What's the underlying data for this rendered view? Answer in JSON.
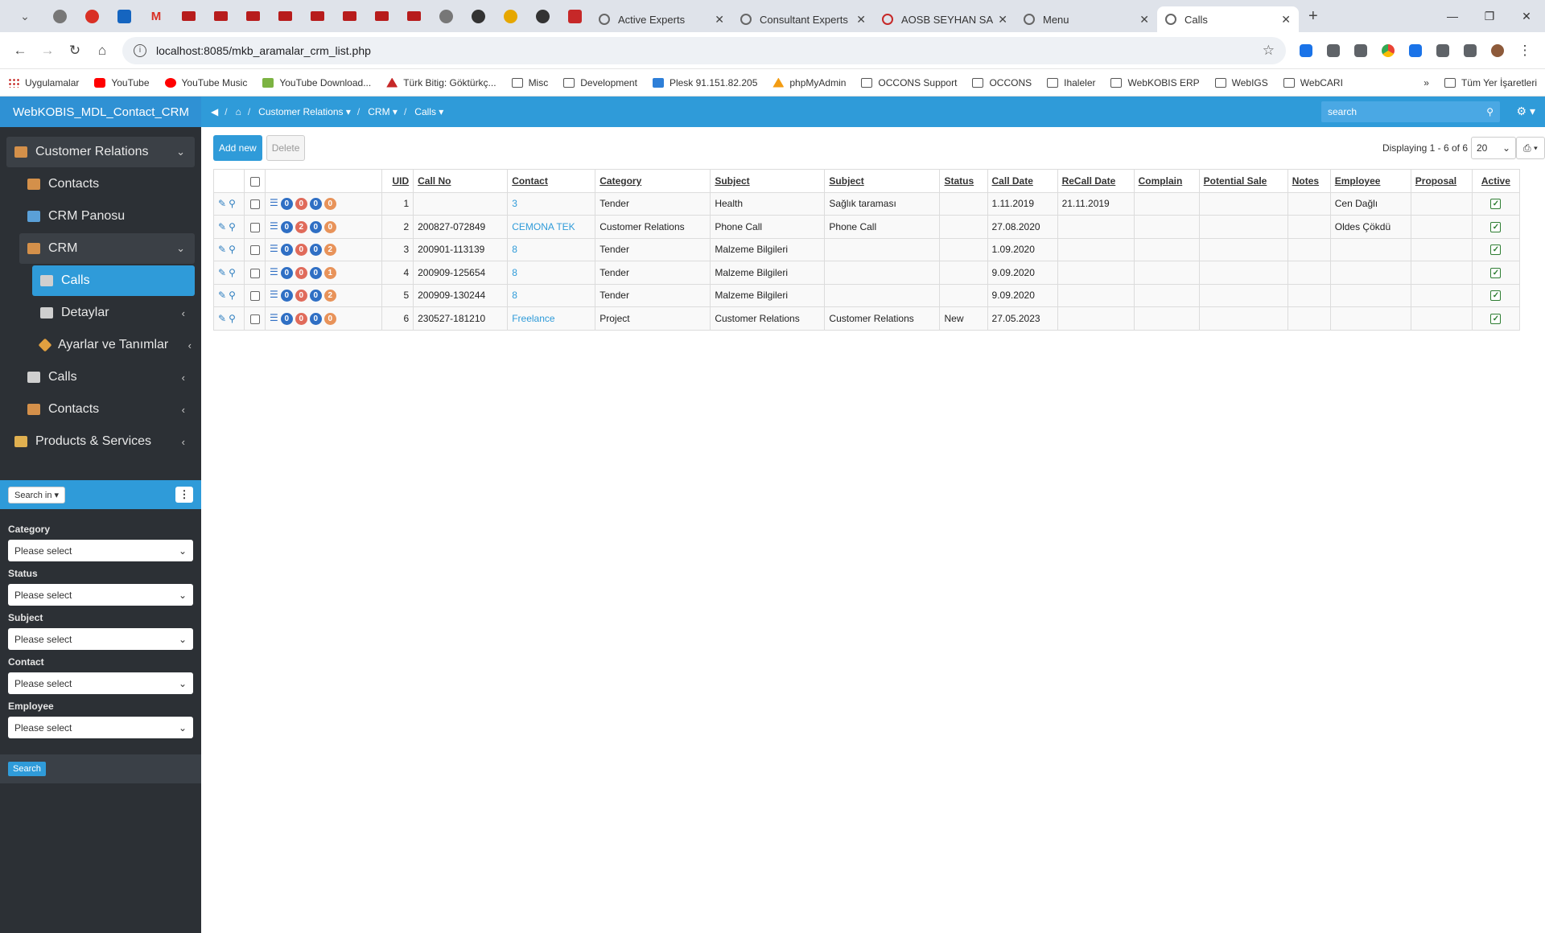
{
  "browser": {
    "tabs": [
      {
        "label": "Active Experts"
      },
      {
        "label": "Consultant Experts"
      },
      {
        "label": "AOSB SEYHAN SAL"
      },
      {
        "label": "Menu"
      },
      {
        "label": "Calls"
      }
    ],
    "url": "localhost:8085/mkb_aramalar_crm_list.php",
    "bookmarks": [
      "Uygulamalar",
      "YouTube",
      "YouTube Music",
      "YouTube Download...",
      "Türk Bitig: Göktürkç...",
      "Misc",
      "Development",
      "Plesk 91.151.82.205",
      "phpMyAdmin",
      "OCCONS Support",
      "OCCONS",
      "Ihaleler",
      "WebKOBIS ERP",
      "WebIGS",
      "WebCARI"
    ],
    "all_bookmarks": "Tüm Yer İşaretleri"
  },
  "app": {
    "brand": "WebKOBIS_MDL_Contact_CRM",
    "menu": {
      "customer_relations": "Customer Relations",
      "contacts": "Contacts",
      "crm_panosu": "CRM Panosu",
      "crm": "CRM",
      "calls": "Calls",
      "detaylar": "Detaylar",
      "ayarlar": "Ayarlar ve Tanımlar",
      "calls2": "Calls",
      "contacts2": "Contacts",
      "products": "Products & Services"
    },
    "search_panel": {
      "search_in": "Search in",
      "fields": [
        {
          "label": "Category",
          "value": "Please select"
        },
        {
          "label": "Status",
          "value": "Please select"
        },
        {
          "label": "Subject",
          "value": "Please select"
        },
        {
          "label": "Contact",
          "value": "Please select"
        },
        {
          "label": "Employee",
          "value": "Please select"
        }
      ],
      "search_button": "Search"
    },
    "breadcrumb": [
      "Customer Relations",
      "CRM",
      "Calls"
    ],
    "top_search_placeholder": "search",
    "toolbar": {
      "add_new": "Add new",
      "delete": "Delete",
      "displaying": "Displaying 1 - 6 of 6",
      "page_size": "20"
    },
    "table": {
      "headers": [
        "UID",
        "Call No",
        "Contact",
        "Category",
        "Subject",
        "Subject",
        "Status",
        "Call Date",
        "ReCall Date",
        "Complain",
        "Potential Sale",
        "Notes",
        "Employee",
        "Proposal",
        "Active"
      ],
      "rows": [
        {
          "badges": [
            "0",
            "0",
            "0",
            "0"
          ],
          "uid": "1",
          "call_no": "",
          "contact": "3",
          "category": "Tender",
          "subject": "Health",
          "subject2": "Sağlık taraması",
          "status": "",
          "call_date": "1.11.2019",
          "recall_date": "21.11.2019",
          "employee": "Cen Dağlı"
        },
        {
          "badges": [
            "0",
            "2",
            "0",
            "0"
          ],
          "uid": "2",
          "call_no": "200827-072849",
          "contact": "CEMONA TEK",
          "category": "Customer Relations",
          "subject": "Phone Call",
          "subject2": "Phone Call",
          "status": "",
          "call_date": "27.08.2020",
          "recall_date": "",
          "employee": "Oldes Çökdü"
        },
        {
          "badges": [
            "0",
            "0",
            "0",
            "2"
          ],
          "uid": "3",
          "call_no": "200901-113139",
          "contact": "8",
          "category": "Tender",
          "subject": "Malzeme Bilgileri",
          "subject2": "",
          "status": "",
          "call_date": "1.09.2020",
          "recall_date": "",
          "employee": ""
        },
        {
          "badges": [
            "0",
            "0",
            "0",
            "1"
          ],
          "uid": "4",
          "call_no": "200909-125654",
          "contact": "8",
          "category": "Tender",
          "subject": "Malzeme Bilgileri",
          "subject2": "",
          "status": "",
          "call_date": "9.09.2020",
          "recall_date": "",
          "employee": ""
        },
        {
          "badges": [
            "0",
            "0",
            "0",
            "2"
          ],
          "uid": "5",
          "call_no": "200909-130244",
          "contact": "8",
          "category": "Tender",
          "subject": "Malzeme Bilgileri",
          "subject2": "",
          "status": "",
          "call_date": "9.09.2020",
          "recall_date": "",
          "employee": ""
        },
        {
          "badges": [
            "0",
            "0",
            "0",
            "0"
          ],
          "uid": "6",
          "call_no": "230527-181210",
          "contact": "Freelance",
          "category": "Project",
          "subject": "Customer Relations",
          "subject2": "Customer Relations",
          "status": "New",
          "call_date": "27.05.2023",
          "recall_date": "",
          "employee": ""
        }
      ]
    }
  }
}
